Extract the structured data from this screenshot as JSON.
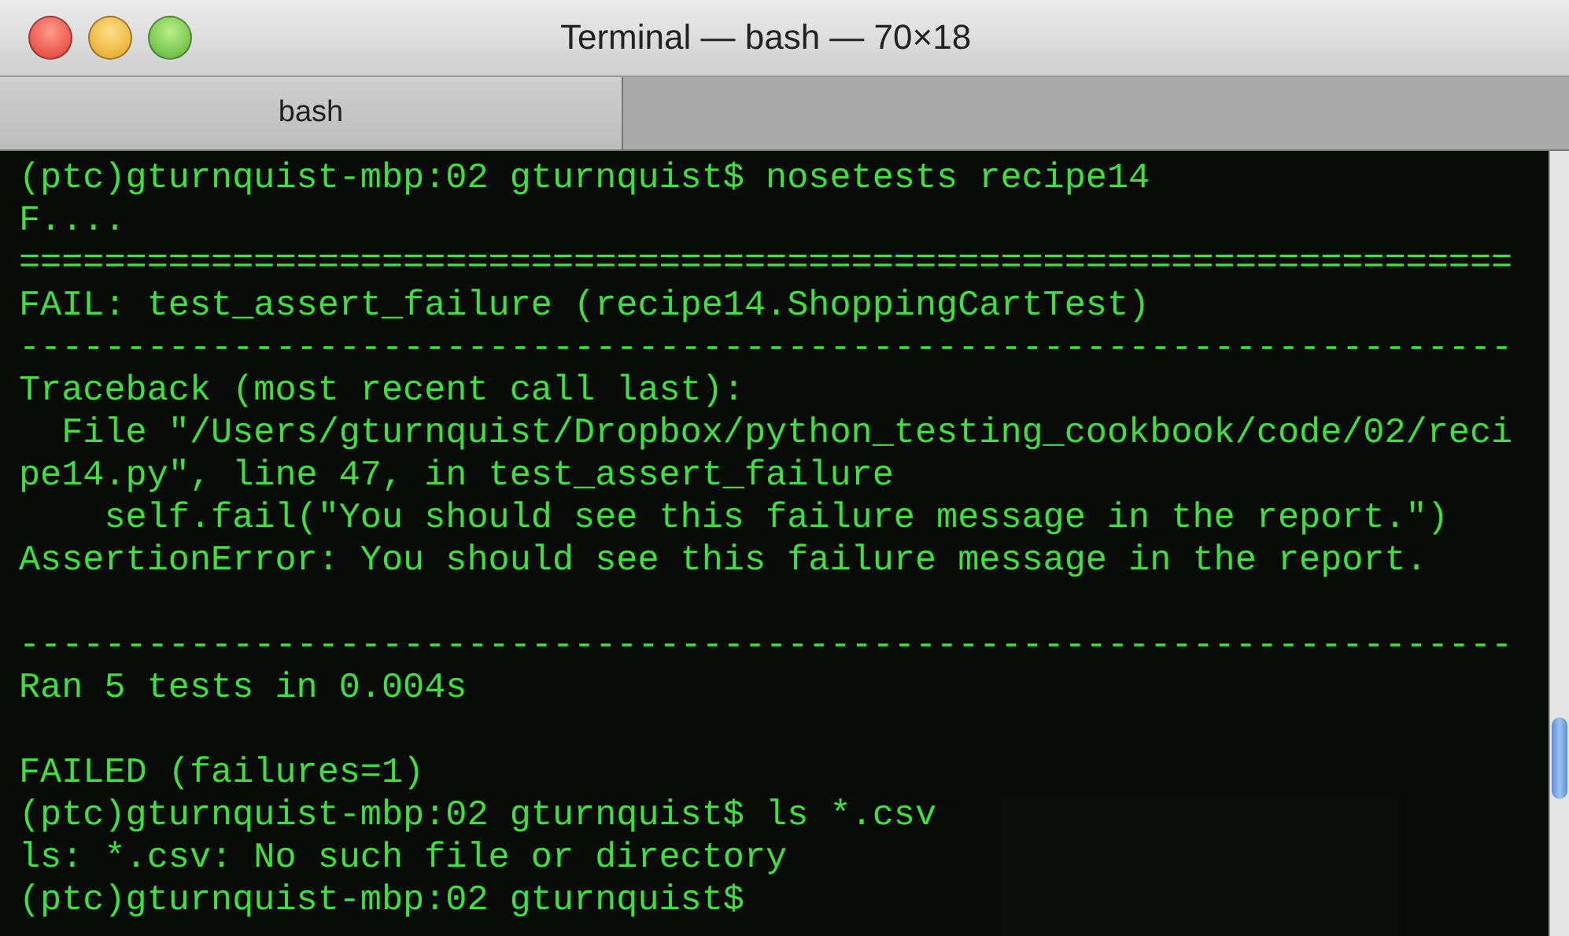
{
  "window": {
    "title": "Terminal — bash — 70×18"
  },
  "tabs": [
    {
      "label": "bash",
      "selected": true
    }
  ],
  "terminal": {
    "blocks": [
      {
        "lines": [
          "(ptc)gturnquist-mbp:02 gturnquist$ nosetests recipe14",
          "F....",
          "======================================================================",
          "FAIL: test_assert_failure (recipe14.ShoppingCartTest)",
          "----------------------------------------------------------------------",
          "Traceback (most recent call last):",
          "  File \"/Users/gturnquist/Dropbox/python_testing_cookbook/code/02/reci",
          "pe14.py\", line 47, in test_assert_failure",
          "    self.fail(\"You should see this failure message in the report.\")",
          "AssertionError: You should see this failure message in the report."
        ]
      },
      {
        "lines": [
          "----------------------------------------------------------------------",
          "Ran 5 tests in 0.004s"
        ]
      },
      {
        "lines": [
          "FAILED (failures=1)",
          "(ptc)gturnquist-mbp:02 gturnquist$ ls *.csv",
          "ls: *.csv: No such file or directory",
          "(ptc)gturnquist-mbp:02 gturnquist$"
        ]
      }
    ]
  }
}
